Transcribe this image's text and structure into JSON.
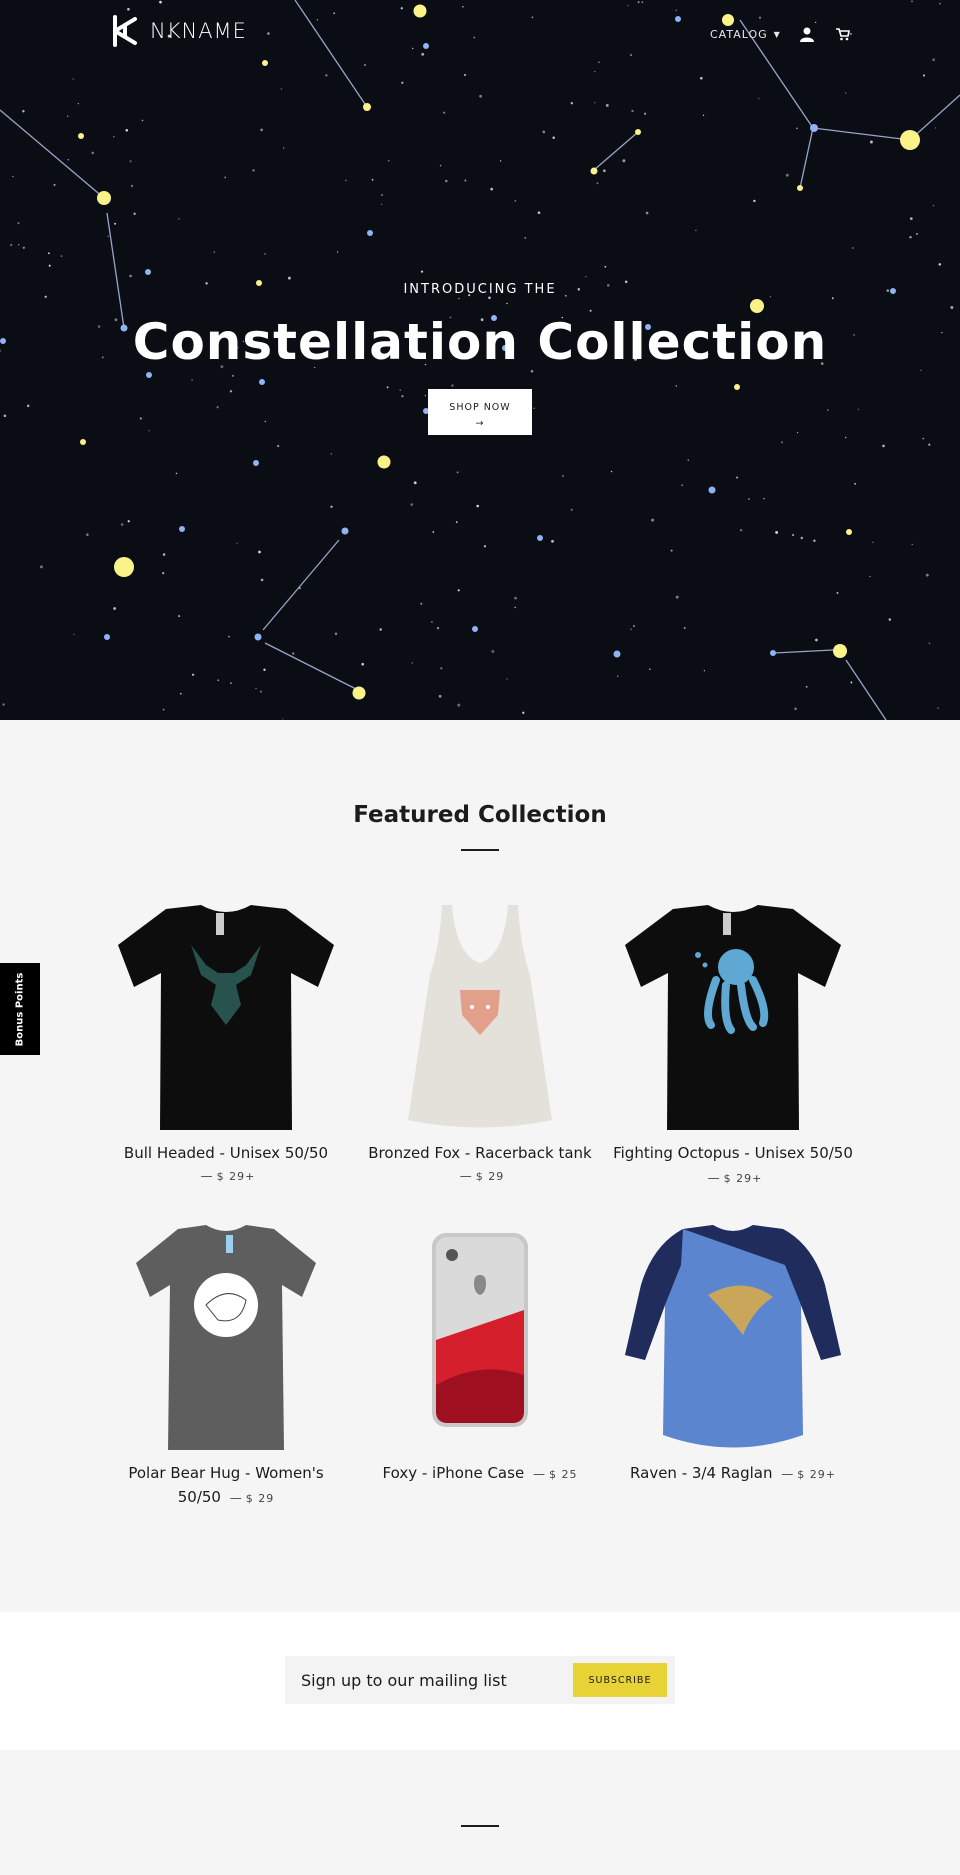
{
  "header": {
    "logo_text": "NKNAME",
    "nav": {
      "catalog": "CATALOG"
    }
  },
  "hero": {
    "kicker": "INTRODUCING THE",
    "title": "Constellation Collection",
    "cta_line1": "SHOP NOW",
    "cta_arrow": "→"
  },
  "featured": {
    "title": "Featured Collection",
    "products": [
      {
        "name": "Bull Headed - Unisex 50/50",
        "price": "$ 29+"
      },
      {
        "name": "Bronzed Fox - Racerback tank",
        "price": "$ 29"
      },
      {
        "name": "Fighting Octopus - Unisex 50/50",
        "price": "$ 29+"
      },
      {
        "name": "Polar Bear Hug - Women's 50/50",
        "price": "$ 29"
      },
      {
        "name": "Foxy - iPhone Case",
        "price": "$ 25"
      },
      {
        "name": "Raven - 3/4 Raglan",
        "price": "$ 29+"
      }
    ],
    "dash": "—"
  },
  "bonus": {
    "label": "Bonus Points"
  },
  "newsletter": {
    "placeholder": "Sign up to our mailing list",
    "button": "SUBSCRIBE"
  },
  "colors": {
    "hero_bg": "#0a0d14",
    "accent_yellow": "#e8d337",
    "page_bg": "#f5f5f5"
  }
}
